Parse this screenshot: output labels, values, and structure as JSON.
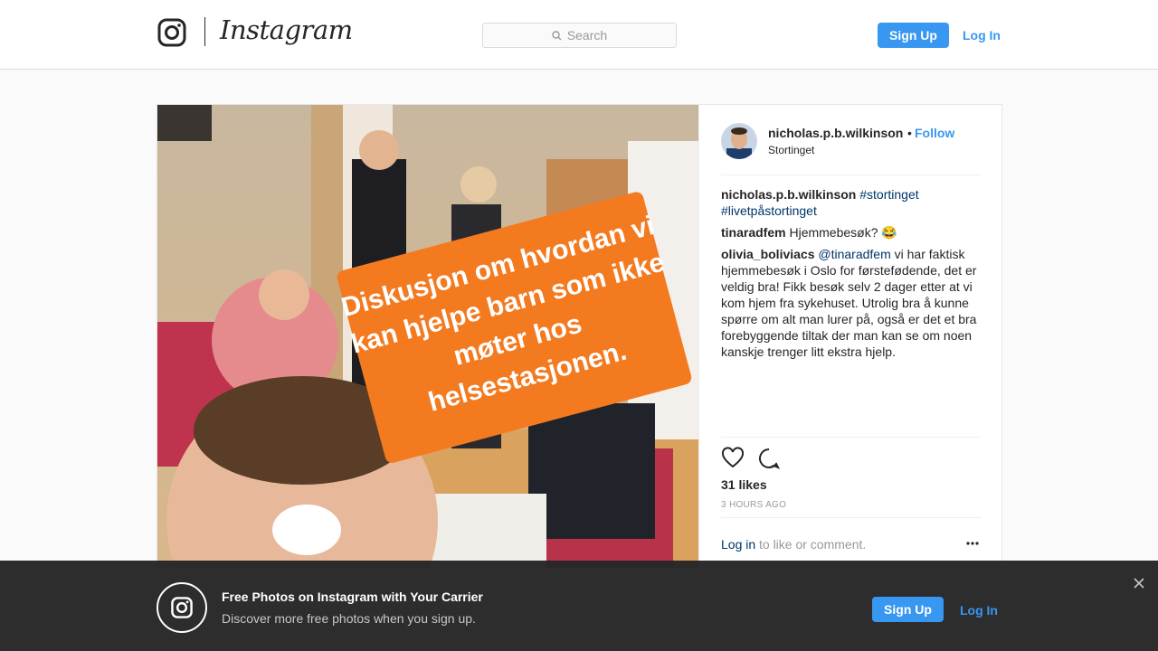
{
  "nav": {
    "brand": "Instagram",
    "search_placeholder": "Search",
    "signup_label": "Sign Up",
    "login_label": "Log In"
  },
  "post": {
    "owner": "nicholas.p.b.wilkinson",
    "separator": "•",
    "follow_label": "Follow",
    "location": "Stortinget",
    "photo_caption_overlay": "Diskusjon om hvordan vi kan hjelpe barn som ikke møter hos helsestasjonen.",
    "comments": [
      {
        "user": "nicholas.p.b.wilkinson",
        "tags": "#stortinget #livetpåstortinget",
        "text": ""
      },
      {
        "user": "tinaradfem",
        "text": "Hjemmebesøk? 😂"
      },
      {
        "user": "olivia_boliviacs",
        "mention": "@tinaradfem",
        "text": "vi har faktisk hjemmebesøk i Oslo for førstefødende, det er veldig bra! Fikk besøk selv 2 dager etter at vi kom hjem fra sykehuset. Utrolig bra å kunne spørre om alt man lurer på, også er det et bra forebyggende tiltak der man kan se om noen kanskje trenger litt ekstra hjelp."
      }
    ],
    "likes": "31 likes",
    "time": "3 HOURS AGO",
    "login_link": "Log in",
    "login_rest": "to like or comment.",
    "icons": {
      "like": "heart-icon",
      "comment": "comment-bubble-icon",
      "more": "more-options-icon"
    }
  },
  "banner": {
    "title": "Free Photos on Instagram with Your Carrier",
    "subtitle": "Discover more free photos when you sign up.",
    "signup_label": "Sign Up",
    "login_label": "Log In"
  },
  "colors": {
    "accent": "#3897f0",
    "tag": "#003569",
    "overlay_orange": "#f47a20"
  }
}
